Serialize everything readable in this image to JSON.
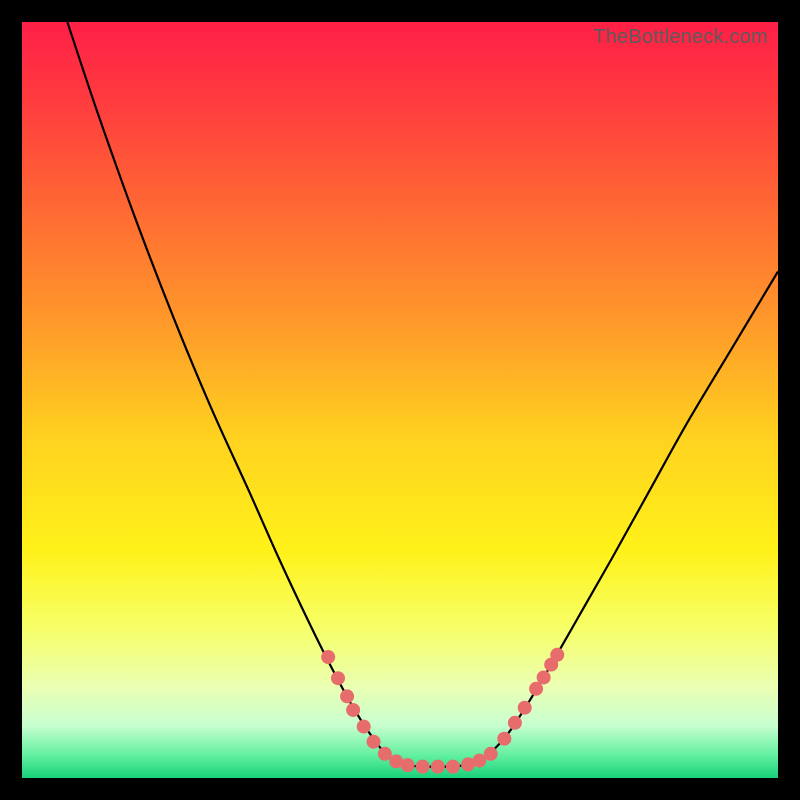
{
  "watermark": "TheBottleneck.com",
  "chart_data": {
    "type": "line",
    "title": "",
    "xlabel": "",
    "ylabel": "",
    "xlim": [
      0,
      100
    ],
    "ylim": [
      0,
      100
    ],
    "background_gradient": {
      "stops": [
        {
          "offset": 0.0,
          "color": "#ff1f47"
        },
        {
          "offset": 0.1,
          "color": "#ff3a3f"
        },
        {
          "offset": 0.25,
          "color": "#ff6a33"
        },
        {
          "offset": 0.4,
          "color": "#ff9a2a"
        },
        {
          "offset": 0.55,
          "color": "#ffd21f"
        },
        {
          "offset": 0.7,
          "color": "#fff21a"
        },
        {
          "offset": 0.8,
          "color": "#f7ff66"
        },
        {
          "offset": 0.88,
          "color": "#eaffb3"
        },
        {
          "offset": 0.93,
          "color": "#c8ffd0"
        },
        {
          "offset": 0.97,
          "color": "#63f0a0"
        },
        {
          "offset": 1.0,
          "color": "#18d17a"
        }
      ]
    },
    "series": [
      {
        "name": "bottleneck-curve",
        "color": "#000000",
        "points": [
          {
            "x": 6.0,
            "y": 100.0
          },
          {
            "x": 10.0,
            "y": 88.0
          },
          {
            "x": 15.0,
            "y": 74.0
          },
          {
            "x": 20.0,
            "y": 61.0
          },
          {
            "x": 25.0,
            "y": 49.0
          },
          {
            "x": 30.0,
            "y": 38.0
          },
          {
            "x": 34.0,
            "y": 29.0
          },
          {
            "x": 38.0,
            "y": 20.5
          },
          {
            "x": 41.0,
            "y": 14.5
          },
          {
            "x": 44.0,
            "y": 9.0
          },
          {
            "x": 47.0,
            "y": 4.5
          },
          {
            "x": 49.0,
            "y": 2.4
          },
          {
            "x": 51.0,
            "y": 1.7
          },
          {
            "x": 53.5,
            "y": 1.5
          },
          {
            "x": 56.0,
            "y": 1.5
          },
          {
            "x": 58.5,
            "y": 1.7
          },
          {
            "x": 61.0,
            "y": 2.6
          },
          {
            "x": 64.0,
            "y": 5.5
          },
          {
            "x": 67.0,
            "y": 10.0
          },
          {
            "x": 70.0,
            "y": 15.0
          },
          {
            "x": 74.0,
            "y": 22.0
          },
          {
            "x": 78.0,
            "y": 29.0
          },
          {
            "x": 83.0,
            "y": 38.0
          },
          {
            "x": 88.0,
            "y": 47.0
          },
          {
            "x": 94.0,
            "y": 57.0
          },
          {
            "x": 100.0,
            "y": 67.0
          }
        ]
      }
    ],
    "markers": {
      "name": "highlight-dots",
      "color": "#e76d6d",
      "radius": 7,
      "points": [
        {
          "x": 40.5,
          "y": 16.0
        },
        {
          "x": 41.8,
          "y": 13.2
        },
        {
          "x": 43.0,
          "y": 10.8
        },
        {
          "x": 43.8,
          "y": 9.0
        },
        {
          "x": 45.2,
          "y": 6.8
        },
        {
          "x": 46.5,
          "y": 4.8
        },
        {
          "x": 48.0,
          "y": 3.2
        },
        {
          "x": 49.5,
          "y": 2.2
        },
        {
          "x": 51.0,
          "y": 1.7
        },
        {
          "x": 53.0,
          "y": 1.5
        },
        {
          "x": 55.0,
          "y": 1.5
        },
        {
          "x": 57.0,
          "y": 1.5
        },
        {
          "x": 59.0,
          "y": 1.8
        },
        {
          "x": 60.5,
          "y": 2.3
        },
        {
          "x": 62.0,
          "y": 3.2
        },
        {
          "x": 63.8,
          "y": 5.2
        },
        {
          "x": 65.2,
          "y": 7.3
        },
        {
          "x": 66.5,
          "y": 9.3
        },
        {
          "x": 68.0,
          "y": 11.8
        },
        {
          "x": 69.0,
          "y": 13.3
        },
        {
          "x": 70.0,
          "y": 15.0
        },
        {
          "x": 70.8,
          "y": 16.3
        }
      ]
    }
  }
}
